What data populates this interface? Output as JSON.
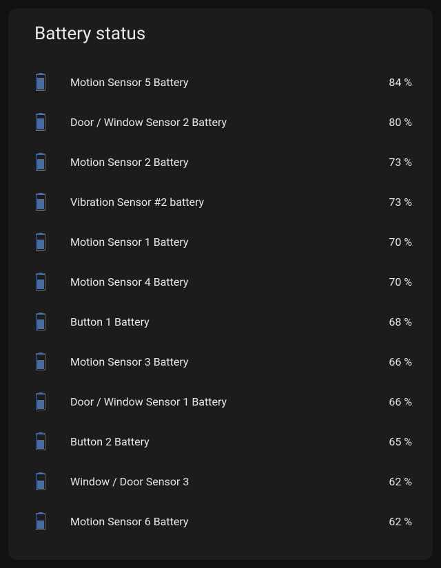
{
  "card": {
    "title": "Battery status",
    "icon_color": "#4a6b9e",
    "items": [
      {
        "label": "Motion Sensor 5 Battery",
        "value": "84 %",
        "level": 84
      },
      {
        "label": "Door / Window Sensor 2 Battery",
        "value": "80 %",
        "level": 80
      },
      {
        "label": "Motion Sensor 2 Battery",
        "value": "73 %",
        "level": 73
      },
      {
        "label": "Vibration Sensor #2 battery",
        "value": "73 %",
        "level": 73
      },
      {
        "label": "Motion Sensor 1 Battery",
        "value": "70 %",
        "level": 70
      },
      {
        "label": "Motion Sensor 4 Battery",
        "value": "70 %",
        "level": 70
      },
      {
        "label": "Button 1 Battery",
        "value": "68 %",
        "level": 68
      },
      {
        "label": "Motion Sensor 3 Battery",
        "value": "66 %",
        "level": 66
      },
      {
        "label": "Door / Window Sensor 1 Battery",
        "value": "66 %",
        "level": 66
      },
      {
        "label": "Button 2 Battery",
        "value": "65 %",
        "level": 65
      },
      {
        "label": "Window / Door Sensor 3",
        "value": "62 %",
        "level": 62
      },
      {
        "label": "Motion Sensor 6 Battery",
        "value": "62 %",
        "level": 62
      }
    ]
  }
}
